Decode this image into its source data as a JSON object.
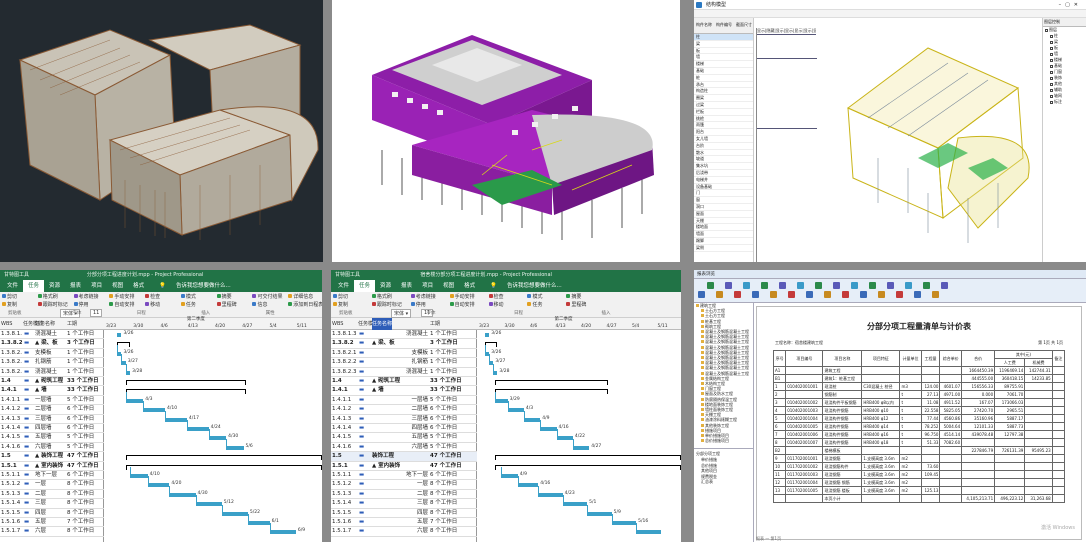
{
  "gantt_left": {
    "title": "分部分项工程进度计划.mpp - Project Professional",
    "tool_tab": "甘特图工具",
    "tabs": [
      "文件",
      "任务",
      "资源",
      "报表",
      "项目",
      "视图",
      "格式"
    ],
    "tell": "告诉我您想要做什么...",
    "groups": [
      "剪贴板",
      "字体",
      "日程",
      "插入",
      "属性"
    ],
    "ribbon_labels": [
      "剪切",
      "复制",
      "格式刷",
      "跟踪时标记",
      "考虑链接",
      "停用",
      "手动安排",
      "自动安排",
      "检查",
      "移动",
      "模式",
      "任务",
      "摘要",
      "里程碑",
      "可交付结果",
      "信息",
      "详细信息",
      "添加到日程表"
    ],
    "font": "宋体",
    "font_size": "11",
    "col_headers": [
      "WBS",
      "任务模式",
      "任务名称",
      "工期"
    ],
    "period_label": "第二季度",
    "date_ticks": [
      "3/23",
      "3/30",
      "4/6",
      "4/13",
      "4/20",
      "4/27",
      "5/4",
      "5/11"
    ],
    "rows": [
      {
        "wbs": "1.3.8.1.3",
        "name": "浇混凝土",
        "dur": "1 个工作日",
        "bold": false
      },
      {
        "wbs": "1.3.8.2",
        "name": "▲ 梁、板",
        "dur": "3 个工作日",
        "bold": true
      },
      {
        "wbs": "1.3.8.2.1",
        "name": "支模板",
        "dur": "1 个工作日",
        "bold": false
      },
      {
        "wbs": "1.3.8.2.2",
        "name": "扎钢筋",
        "dur": "1 个工作日",
        "bold": false
      },
      {
        "wbs": "1.3.8.2.3",
        "name": "浇混凝土",
        "dur": "1 个工作日",
        "bold": false
      },
      {
        "wbs": "1.4",
        "name": "▲ 砌筑工程",
        "dur": "33 个工作日",
        "bold": true
      },
      {
        "wbs": "1.4.1",
        "name": "▲ 墙",
        "dur": "33 个工作日",
        "bold": true
      },
      {
        "wbs": "1.4.1.1",
        "name": "一层墙",
        "dur": "5 个工作日",
        "bold": false
      },
      {
        "wbs": "1.4.1.2",
        "name": "二层墙",
        "dur": "6 个工作日",
        "bold": false
      },
      {
        "wbs": "1.4.1.3",
        "name": "三层墙",
        "dur": "6 个工作日",
        "bold": false
      },
      {
        "wbs": "1.4.1.4",
        "name": "四层墙",
        "dur": "6 个工作日",
        "bold": false
      },
      {
        "wbs": "1.4.1.5",
        "name": "五层墙",
        "dur": "5 个工作日",
        "bold": false
      },
      {
        "wbs": "1.4.1.6",
        "name": "六层墙",
        "dur": "5 个工作日",
        "bold": false
      },
      {
        "wbs": "1.5",
        "name": "▲ 装饰工程",
        "dur": "47 个工作日",
        "bold": true
      },
      {
        "wbs": "1.5.1",
        "name": "▲ 室内装饰",
        "dur": "47 个工作日",
        "bold": true
      },
      {
        "wbs": "1.5.1.1",
        "name": "地下一层",
        "dur": "6 个工作日",
        "bold": false
      },
      {
        "wbs": "1.5.1.2",
        "name": "一层",
        "dur": "8 个工作日",
        "bold": false
      },
      {
        "wbs": "1.5.1.3",
        "name": "二层",
        "dur": "8 个工作日",
        "bold": false
      },
      {
        "wbs": "1.5.1.4",
        "name": "三层",
        "dur": "8 个工作日",
        "bold": false
      },
      {
        "wbs": "1.5.1.5",
        "name": "四层",
        "dur": "8 个工作日",
        "bold": false
      },
      {
        "wbs": "1.5.1.6",
        "name": "五层",
        "dur": "7 个工作日",
        "bold": false
      },
      {
        "wbs": "1.5.1.7",
        "name": "六层",
        "dur": "8 个工作日",
        "bold": false
      }
    ],
    "bars": [
      {
        "label": "3/26",
        "start": 0.06,
        "len": 0.02,
        "sum": false
      },
      {
        "label": "",
        "start": 0.06,
        "len": 0.06,
        "sum": true
      },
      {
        "label": "3/26",
        "start": 0.06,
        "len": 0.02,
        "sum": false
      },
      {
        "label": "3/27",
        "start": 0.08,
        "len": 0.02,
        "sum": false
      },
      {
        "label": "3/28",
        "start": 0.1,
        "len": 0.02,
        "sum": false
      },
      {
        "label": "",
        "start": 0.1,
        "len": 0.55,
        "sum": true
      },
      {
        "label": "",
        "start": 0.1,
        "len": 0.55,
        "sum": true
      },
      {
        "label": "4/3",
        "start": 0.1,
        "len": 0.08,
        "sum": false
      },
      {
        "label": "4/10",
        "start": 0.18,
        "len": 0.1,
        "sum": false
      },
      {
        "label": "4/17",
        "start": 0.28,
        "len": 0.1,
        "sum": false
      },
      {
        "label": "4/24",
        "start": 0.38,
        "len": 0.1,
        "sum": false
      },
      {
        "label": "4/30",
        "start": 0.48,
        "len": 0.08,
        "sum": false
      },
      {
        "label": "5/6",
        "start": 0.56,
        "len": 0.08,
        "sum": false
      },
      {
        "label": "",
        "start": 0.1,
        "len": 0.9,
        "sum": true
      },
      {
        "label": "",
        "start": 0.1,
        "len": 0.9,
        "sum": true
      },
      {
        "label": "4/10",
        "start": 0.12,
        "len": 0.08,
        "sum": false
      },
      {
        "label": "4/20",
        "start": 0.2,
        "len": 0.1,
        "sum": false
      },
      {
        "label": "4/30",
        "start": 0.3,
        "len": 0.12,
        "sum": false
      },
      {
        "label": "5/12",
        "start": 0.42,
        "len": 0.12,
        "sum": false
      },
      {
        "label": "5/22",
        "start": 0.54,
        "len": 0.12,
        "sum": false
      },
      {
        "label": "6/1",
        "start": 0.66,
        "len": 0.1,
        "sum": false
      },
      {
        "label": "6/9",
        "start": 0.76,
        "len": 0.12,
        "sum": false
      }
    ]
  },
  "gantt_right": {
    "title": "宿舍楼分部分项工程进度计划.mpp - Project Professional",
    "tool_tab": "甘特图工具",
    "tabs": [
      "文件",
      "任务",
      "资源",
      "报表",
      "项目",
      "视图",
      "格式"
    ],
    "tell": "告诉我您想要做什么...",
    "groups": [
      "剪贴板",
      "字体",
      "日程",
      "插入"
    ],
    "ribbon_labels": [
      "剪切",
      "复制",
      "格式刷",
      "跟踪时标记",
      "考虑链接",
      "停用",
      "手动安排",
      "自动安排",
      "检查",
      "移动",
      "模式",
      "任务",
      "摘要",
      "里程碑"
    ],
    "font": "宋体",
    "font_size": "11",
    "col_headers": [
      "WBS",
      "任务模式",
      "任务名称",
      "工期"
    ],
    "period_label": "第二季度",
    "date_ticks": [
      "3/23",
      "3/30",
      "4/6",
      "4/13",
      "4/20",
      "4/27",
      "5/4",
      "5/11"
    ],
    "rows": [
      {
        "wbs": "1.3.8.1.3",
        "name": "浇混凝土",
        "dur": "1 个工作日",
        "bold": false
      },
      {
        "wbs": "1.3.8.2",
        "name": "▲ 梁、板",
        "dur": "3 个工作日",
        "bold": true
      },
      {
        "wbs": "1.3.8.2.1",
        "name": "支模板",
        "dur": "1 个工作日",
        "bold": false
      },
      {
        "wbs": "1.3.8.2.2",
        "name": "扎钢筋",
        "dur": "1 个工作日",
        "bold": false
      },
      {
        "wbs": "1.3.8.2.3",
        "name": "浇混凝土",
        "dur": "1 个工作日",
        "bold": false
      },
      {
        "wbs": "1.4",
        "name": "▲ 砌筑工程",
        "dur": "33 个工作日",
        "bold": true
      },
      {
        "wbs": "1.4.1",
        "name": "▲ 墙",
        "dur": "33 个工作日",
        "bold": true
      },
      {
        "wbs": "1.4.1.1",
        "name": "一层墙",
        "dur": "5 个工作日",
        "bold": false
      },
      {
        "wbs": "1.4.1.2",
        "name": "二层墙",
        "dur": "6 个工作日",
        "bold": false
      },
      {
        "wbs": "1.4.1.3",
        "name": "三层墙",
        "dur": "6 个工作日",
        "bold": false
      },
      {
        "wbs": "1.4.1.4",
        "name": "四层墙",
        "dur": "6 个工作日",
        "bold": false
      },
      {
        "wbs": "1.4.1.5",
        "name": "五层墙",
        "dur": "5 个工作日",
        "bold": false
      },
      {
        "wbs": "1.4.1.6",
        "name": "六层墙",
        "dur": "5 个工作日",
        "bold": false
      },
      {
        "wbs": "1.5",
        "name": "装饰工程",
        "dur": "47 个工作日",
        "bold": true
      },
      {
        "wbs": "1.5.1",
        "name": "▲ 室内装饰",
        "dur": "47 个工作日",
        "bold": true
      },
      {
        "wbs": "1.5.1.1",
        "name": "地下一层",
        "dur": "6 个工作日",
        "bold": false
      },
      {
        "wbs": "1.5.1.2",
        "name": "一层",
        "dur": "8 个工作日",
        "bold": false
      },
      {
        "wbs": "1.5.1.3",
        "name": "二层",
        "dur": "8 个工作日",
        "bold": false
      },
      {
        "wbs": "1.5.1.4",
        "name": "三层",
        "dur": "8 个工作日",
        "bold": false
      },
      {
        "wbs": "1.5.1.5",
        "name": "四层",
        "dur": "8 个工作日",
        "bold": false
      },
      {
        "wbs": "1.5.1.6",
        "name": "五层",
        "dur": "7 个工作日",
        "bold": false
      },
      {
        "wbs": "1.5.1.7",
        "name": "六层",
        "dur": "8 个工作日",
        "bold": false
      }
    ],
    "bars": [
      {
        "label": "3/26",
        "start": 0.04,
        "len": 0.02,
        "sum": false
      },
      {
        "label": "",
        "start": 0.04,
        "len": 0.06,
        "sum": true
      },
      {
        "label": "3/26",
        "start": 0.04,
        "len": 0.02,
        "sum": false
      },
      {
        "label": "3/27",
        "start": 0.06,
        "len": 0.02,
        "sum": false
      },
      {
        "label": "3/28",
        "start": 0.08,
        "len": 0.02,
        "sum": false
      },
      {
        "label": "",
        "start": 0.09,
        "len": 0.55,
        "sum": true
      },
      {
        "label": "",
        "start": 0.09,
        "len": 0.55,
        "sum": true
      },
      {
        "label": "3/29",
        "start": 0.09,
        "len": 0.06,
        "sum": false
      },
      {
        "label": "4/3",
        "start": 0.15,
        "len": 0.08,
        "sum": false
      },
      {
        "label": "4/9",
        "start": 0.23,
        "len": 0.08,
        "sum": false
      },
      {
        "label": "4/16",
        "start": 0.31,
        "len": 0.08,
        "sum": false
      },
      {
        "label": "4/22",
        "start": 0.39,
        "len": 0.08,
        "sum": false
      },
      {
        "label": "4/27",
        "start": 0.47,
        "len": 0.08,
        "sum": false
      },
      {
        "label": "",
        "start": 0.09,
        "len": 0.91,
        "sum": true
      },
      {
        "label": "",
        "start": 0.09,
        "len": 0.91,
        "sum": true
      },
      {
        "label": "4/9",
        "start": 0.12,
        "len": 0.08,
        "sum": false
      },
      {
        "label": "4/16",
        "start": 0.2,
        "len": 0.1,
        "sum": false
      },
      {
        "label": "4/23",
        "start": 0.3,
        "len": 0.12,
        "sum": false
      },
      {
        "label": "5/1",
        "start": 0.42,
        "len": 0.12,
        "sum": false
      },
      {
        "label": "5/9",
        "start": 0.54,
        "len": 0.12,
        "sum": false
      },
      {
        "label": "5/16",
        "start": 0.66,
        "len": 0.12,
        "sum": false
      },
      {
        "label": "",
        "start": 0.78,
        "len": 0.12,
        "sum": false
      }
    ]
  },
  "bill": {
    "title": "分部分项工程量清单与计价表",
    "sub_left": "工程名称：宿舍楼建筑工程",
    "sub_right": "第 1页 共 1页",
    "headers": [
      "序号",
      "项目编号",
      "项目名称",
      "项目特征",
      "计量单位",
      "工程量",
      "综合单价",
      "合价",
      "其中(元)",
      "人工费",
      "机械费",
      "备注"
    ],
    "rows": [
      [
        "A1",
        "",
        "建筑工程",
        "",
        "",
        "",
        "",
        "1664450.39",
        "1196469.14",
        "142744.31"
      ],
      [
        "B1",
        "",
        "建筑1：桩基工程",
        "",
        "",
        "",
        "",
        "444555.00",
        "360418.15",
        "14233.85"
      ],
      [
        "1",
        "010402001001",
        "现浇桩",
        "C30混凝土 桩径",
        "m3",
        "124.00",
        "4601.07",
        "156556.33",
        "89755.91",
        ""
      ],
      [
        "2",
        "",
        "钢筋制",
        "",
        "t",
        "27.13",
        "4971.00",
        "0.000",
        "7061.70",
        ""
      ],
      [
        "3",
        "010402001002",
        "现浇构件平板钢筋",
        "HRB400 φ8以内",
        "t",
        "11.08",
        "4911.52",
        "167.07",
        "173066.03",
        ""
      ],
      [
        "4",
        "010402001003",
        "现浇构件钢筋",
        "HRB400 φ10",
        "t",
        "22.558",
        "5825.05",
        "27420.70",
        "2965.51",
        ""
      ],
      [
        "5",
        "010402001004",
        "现浇构件钢筋",
        "HRB400 φ12",
        "t",
        "77.44",
        "4560.86",
        "35160.96",
        "5887.17",
        ""
      ],
      [
        "6",
        "010402001005",
        "现浇构件钢筋",
        "HRB400 φ14",
        "t",
        "78.252",
        "5004.64",
        "12101.33",
        "5887.73",
        ""
      ],
      [
        "7",
        "010402001006",
        "现浇构件钢筋",
        "HRB400 φ16",
        "t",
        "96.750",
        "4514.14",
        "439078.48",
        "12797.38",
        ""
      ],
      [
        "8",
        "010402001007",
        "现浇构件钢筋",
        "HRB400 φ18",
        "t",
        "51.33",
        "7082.60",
        "",
        "",
        ""
      ],
      [
        "B2",
        "",
        "楼梯模板",
        "",
        "",
        "",
        "",
        "227846.79",
        "726131.39",
        "95495.23"
      ],
      [
        "9",
        "011702001001",
        "现浇钢筋",
        "1.支模高度 3.6m",
        "m2",
        "",
        "",
        "",
        "",
        ""
      ],
      [
        "10",
        "011702001002",
        "现浇钢筋构件",
        "1.支模高度 3.6m",
        "m2",
        "73.60",
        "",
        "",
        "",
        ""
      ],
      [
        "11",
        "011702001003",
        "现浇钢筋",
        "1.支模高度 3.6m",
        "m2",
        "109.45",
        "",
        "",
        "",
        ""
      ],
      [
        "12",
        "011702001004",
        "现浇钢筋 钢筋",
        "1.支模高度 3.6m",
        "m2",
        "",
        "",
        "",
        "",
        ""
      ],
      [
        "13",
        "011702001005",
        "现浇钢筋 楼板",
        "1.支模高度 3.6m",
        "m2",
        "125.13",
        "",
        "",
        "",
        ""
      ],
      [
        "",
        "",
        "本页小计",
        "",
        "",
        "",
        "",
        "4,105,213.71",
        "496,223.12",
        "31,263.68"
      ]
    ],
    "tree": [
      "建筑工程",
      "土石方工程",
      "土石方工程",
      "桩基工程",
      "砌筑工程",
      "混凝土及钢筋混凝土工程",
      "混凝土及钢筋混凝土工程",
      "混凝土及钢筋混凝土工程",
      "混凝土及钢筋混凝土工程",
      "混凝土及钢筋混凝土工程",
      "混凝土及钢筋混凝土工程",
      "混凝土及钢筋混凝土工程",
      "混凝土及钢筋混凝土工程",
      "混凝土及钢筋混凝土工程",
      "金属结构工程",
      "木结构工程",
      "门窗工程",
      "屋面及防水工程",
      "防腐隔热保温工程",
      "楼地面装饰工程",
      "墙柱面装饰工程",
      "天棚工程",
      "油漆涂料裱糊工程",
      "其他装饰工程",
      "措施项目",
      "单价措施项目",
      "总价措施项目"
    ],
    "tree_lower": [
      "分部分项工程",
      "单价措施",
      "总价措施",
      "其他项目",
      "规费税金",
      "汇总表"
    ],
    "toolbar_title": "报表浏览",
    "status": "报表 — 第1页",
    "watermark": "激活 Windows"
  },
  "model_app": {
    "title": "结构模型",
    "list_headers": [
      "构件名称",
      "构件编号",
      "截面尺寸"
    ],
    "columns_header": "显示|隐藏|显示|显示|显示|显示|显示",
    "tree_title": "图层控制",
    "list_rows": [
      "柱",
      "梁",
      "板",
      "墙",
      "楼梯",
      "基础",
      "桩",
      "承台",
      "构造柱",
      "圈梁",
      "过梁",
      "栏板",
      "挑檐",
      "雨篷",
      "阳台",
      "女儿墙",
      "台阶",
      "散水",
      "坡道",
      "集水坑",
      "后浇带",
      "电梯井",
      "设备基础",
      "门",
      "窗",
      "洞口",
      "屋面",
      "天棚",
      "楼地面",
      "墙面",
      "踢脚",
      "梁侧"
    ],
    "tree_items": [
      "图层",
      "柱",
      "梁",
      "板",
      "墙",
      "楼梯",
      "基础",
      "门窗",
      "装饰",
      "其他",
      "辅助",
      "轴网",
      "标注"
    ]
  }
}
